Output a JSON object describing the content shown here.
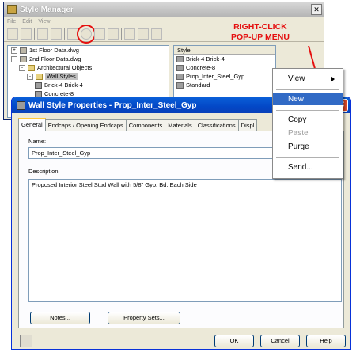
{
  "style_manager": {
    "title": "Style Manager",
    "menu": [
      "File",
      "Edit",
      "View"
    ],
    "tree": [
      {
        "label": "1st Floor Data.dwg",
        "indent": 0,
        "expander": "+",
        "icon": "dwg"
      },
      {
        "label": "2nd Floor Data.dwg",
        "indent": 0,
        "expander": "-",
        "icon": "dwg"
      },
      {
        "label": "Architectural Objects",
        "indent": 1,
        "expander": "-",
        "icon": "fold"
      },
      {
        "label": "Wall Styles",
        "indent": 2,
        "expander": "-",
        "icon": "fold",
        "selected": true
      },
      {
        "label": "Brick-4 Brick-4",
        "indent": 3,
        "expander": "",
        "icon": "wall"
      },
      {
        "label": "Concrete-8",
        "indent": 3,
        "expander": "",
        "icon": "wall"
      },
      {
        "label": "Prop_Inter_Steel_Gyp",
        "indent": 3,
        "expander": "",
        "icon": "wall"
      },
      {
        "label": "Standard",
        "indent": 3,
        "expander": "",
        "icon": "wall"
      }
    ],
    "list_header": "Style",
    "list": [
      "Brick-4 Brick-4",
      "Concrete-8",
      "Prop_Inter_Steel_Gyp",
      "Standard"
    ]
  },
  "annotation": {
    "line1": "RIGHT-CLICK",
    "line2": "POP-UP MENU",
    "color": "#e51010"
  },
  "context_menu": {
    "items": [
      {
        "label": "View",
        "submenu": true
      },
      {
        "label": "New",
        "active": true
      },
      {
        "label": "Copy"
      },
      {
        "label": "Paste",
        "disabled": true
      },
      {
        "label": "Purge"
      },
      {
        "label": "Send..."
      }
    ]
  },
  "dialog": {
    "title": "Wall Style Properties - Prop_Inter_Steel_Gyp",
    "tabs": [
      "General",
      "Endcaps / Opening Endcaps",
      "Components",
      "Materials",
      "Classifications",
      "Displ"
    ],
    "name_label": "Name:",
    "name_value": "Prop_Inter_Steel_Gyp",
    "description_label": "Description:",
    "description_value": "Proposed Interior Steel Stud Wall with 5/8\" Gyp. Bd. Each Side",
    "notes_button": "Notes...",
    "property_sets_button": "Property Sets...",
    "ok_button": "OK",
    "cancel_button": "Cancel",
    "help_button": "Help"
  },
  "colors": {
    "title_blue": "#0347c6",
    "selection_blue": "#316ac5",
    "highlight_red": "#e51010"
  }
}
